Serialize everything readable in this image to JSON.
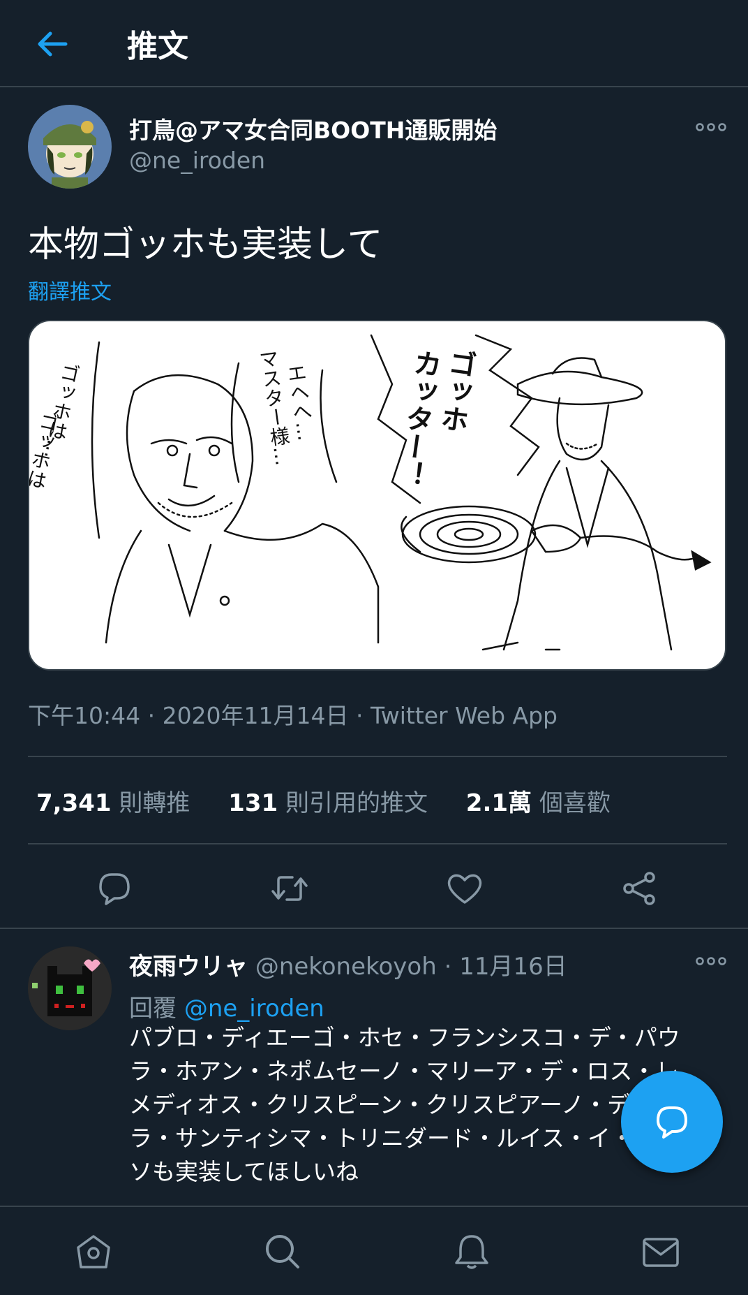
{
  "header": {
    "title": "推文"
  },
  "tweet": {
    "author_name": "打鳥@アマ女合同BOOTH通販開始",
    "author_handle": "@ne_iroden",
    "text": "本物ゴッホも実装して",
    "translate_label": "翻譯推文",
    "timestamp": "下午10:44 · 2020年11月14日 · Twitter Web App",
    "stats": {
      "retweets_count": "7,341",
      "retweets_label": "則轉推",
      "quotes_count": "131",
      "quotes_label": "則引用的推文",
      "likes_count": "2.1萬",
      "likes_label": "個喜歡"
    },
    "media_caption_texts": [
      "ゴッホは…",
      "ゴッホは…",
      "エヘへ… マスター様…",
      "ゴッホ カッター！"
    ]
  },
  "actions": [
    "reply-icon",
    "retweet-icon",
    "like-icon",
    "share-icon"
  ],
  "reply": {
    "name": "夜雨ウリャ",
    "handle": "@nekonekoyoh",
    "date": "· 11月16日",
    "replying_prefix": "回覆",
    "replying_to": "@ne_iroden",
    "lines": [
      "パブロ・ディエーゴ・ホセ・フランシスコ・デ・パウ",
      "ラ・ホアン・ネポムセーノ・マリーア・デ・ロス・レ",
      "メディオス・クリスピーン・クリスピアーノ・デ・",
      "ラ・サンティシマ・トリニダード・ルイス・イ・ピカ",
      "ソも実装してほしいね"
    ]
  },
  "bottom_nav": [
    "home-icon",
    "search-icon",
    "notifications-icon",
    "messages-icon"
  ],
  "colors": {
    "background": "#15202b",
    "accent": "#1da1f2",
    "secondary_text": "#8899a6",
    "divider": "#38444d"
  }
}
